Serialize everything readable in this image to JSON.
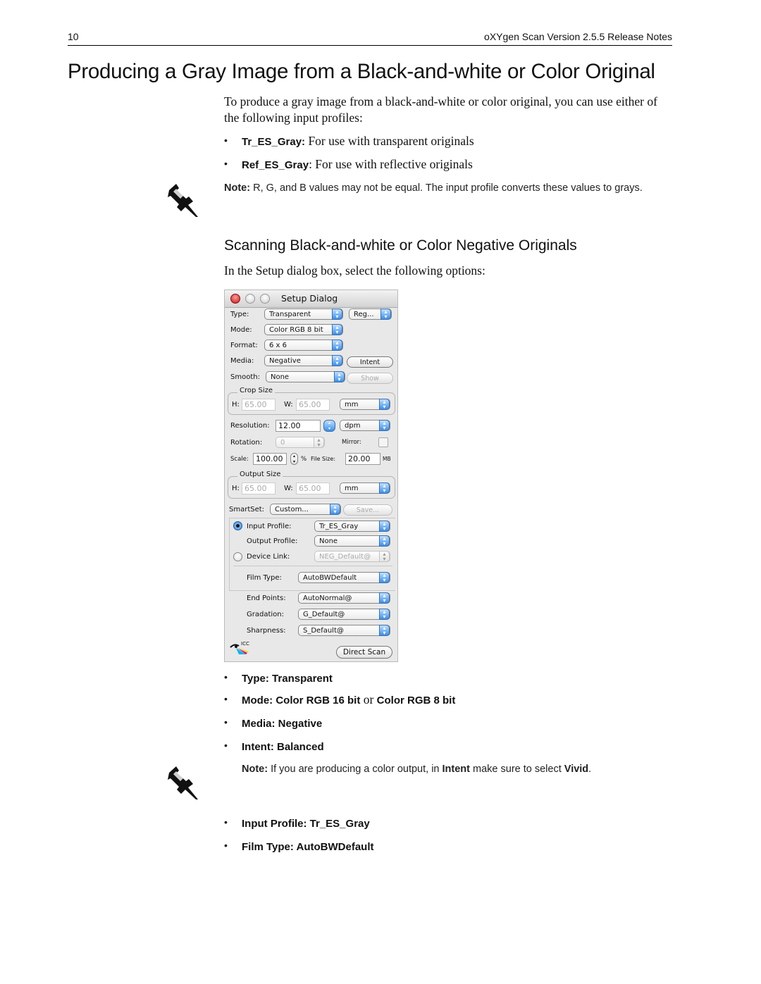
{
  "header": {
    "page_number": "10",
    "doc_title": "oXYgen Scan Version 2.5.5 Release Notes"
  },
  "section1": {
    "title": "Producing a Gray Image from a Black-and-white or Color Original",
    "intro": "To produce a gray image from a black-and-white or color original, you can use either of the following input profiles:",
    "bullets": [
      {
        "term": "Tr_ES_Gray:",
        "text": " For use with transparent originals"
      },
      {
        "term": "Ref_ES_Gray",
        "text": ": For use with reflective originals"
      }
    ],
    "note": {
      "label": "Note:",
      "text": "  R, G, and B values may not be equal. The input profile converts these values to grays.",
      "icon": "pushpin-icon"
    }
  },
  "section2": {
    "title": "Scanning Black-and-white or Color Negative Originals",
    "intro": "In the Setup dialog box, select the following options:",
    "bullets": [
      {
        "term": "Type: Transparent"
      },
      {
        "term": "Mode: Color RGB 16 bit",
        "mid": " or ",
        "term2": "Color RGB 8 bit"
      },
      {
        "term": "Media: Negative"
      },
      {
        "term": "Intent: Balanced"
      }
    ],
    "note": {
      "label": "Note:",
      "pre": "  If you are producing a color output, in ",
      "b1": "Intent",
      "mid": " make sure to select ",
      "b2": "Vivid",
      "post": ".",
      "icon": "pushpin-icon"
    },
    "bullets2": [
      {
        "term": "Input Profile: Tr_ES_Gray"
      },
      {
        "term": "Film Type: AutoBWDefault"
      }
    ]
  },
  "dialog": {
    "title": "Setup Dialog",
    "type": {
      "label": "Type:",
      "value": "Transparent",
      "extra": "Reg..."
    },
    "mode": {
      "label": "Mode:",
      "value": "Color RGB 8 bit"
    },
    "format": {
      "label": "Format:",
      "value": "6 x 6"
    },
    "media": {
      "label": "Media:",
      "value": "Negative",
      "button": "Intent"
    },
    "smooth": {
      "label": "Smooth:",
      "value": "None",
      "button": "Show"
    },
    "crop": {
      "title": "Crop Size",
      "h_label": "H:",
      "h": "65.00",
      "w_label": "W:",
      "w": "65.00",
      "unit": "mm"
    },
    "resolution": {
      "label": "Resolution:",
      "value": "12.00",
      "unit": "dpm"
    },
    "rotation": {
      "label": "Rotation:",
      "value": "0",
      "mirror_label": "Mirror:",
      "mirror_checked": false
    },
    "scale": {
      "label": "Scale:",
      "value": "100.00",
      "pct": "%",
      "filesize_label": "File Size:",
      "filesize": "20.00",
      "filesize_unit": "MB"
    },
    "output": {
      "title": "Output Size",
      "h_label": "H:",
      "h": "65.00",
      "w_label": "W:",
      "w": "65.00",
      "unit": "mm"
    },
    "smartset": {
      "label": "SmartSet:",
      "value": "Custom...",
      "button": "Save..."
    },
    "input_profile": {
      "label": "Input Profile:",
      "value": "Tr_ES_Gray",
      "selected": true
    },
    "output_profile": {
      "label": "Output Profile:",
      "value": "None"
    },
    "device_link": {
      "label": "Device Link:",
      "value": "NEG_Default@",
      "selected": false
    },
    "film_type": {
      "label": "Film Type:",
      "value": "AutoBWDefault"
    },
    "end_points": {
      "label": "End Points:",
      "value": "AutoNormal@"
    },
    "gradation": {
      "label": "Gradation:",
      "value": "G_Default@"
    },
    "sharpness": {
      "label": "Sharpness:",
      "value": "S_Default@"
    },
    "icc_logo": "ICC",
    "direct_scan": "Direct Scan"
  }
}
